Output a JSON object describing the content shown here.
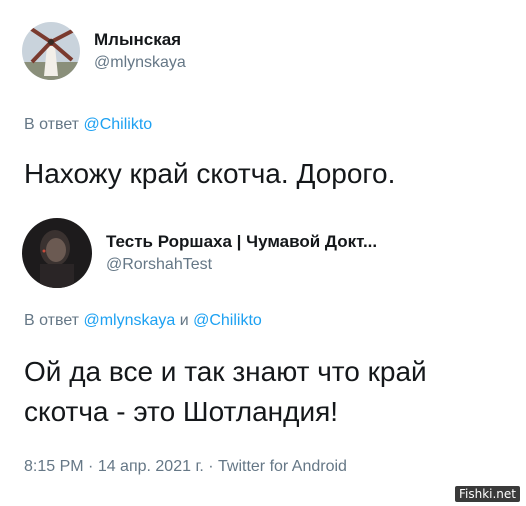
{
  "tweet1": {
    "display_name": "Млынская",
    "handle": "@mlynskaya",
    "reply_prefix": "В ответ ",
    "reply_to": "@Chilikto",
    "text": "Нахожу край скотча. Дорого."
  },
  "tweet2": {
    "display_name": "Тесть Роршаха | Чумавой Докт...",
    "handle": "@RorshahTest",
    "reply_prefix": "В ответ ",
    "reply_to_1": "@mlynskaya",
    "reply_conjunction": " и ",
    "reply_to_2": "@Chilikto",
    "text": "Ой да все и так знают что край скотча - это Шотландия!",
    "time": "8:15 PM",
    "separator": " · ",
    "date": "14 апр. 2021 г.",
    "source": "Twitter for Android"
  },
  "watermark": "Fishki.net",
  "colors": {
    "link": "#1da1f2",
    "secondary_text": "#657786",
    "primary_text": "#14171a"
  }
}
